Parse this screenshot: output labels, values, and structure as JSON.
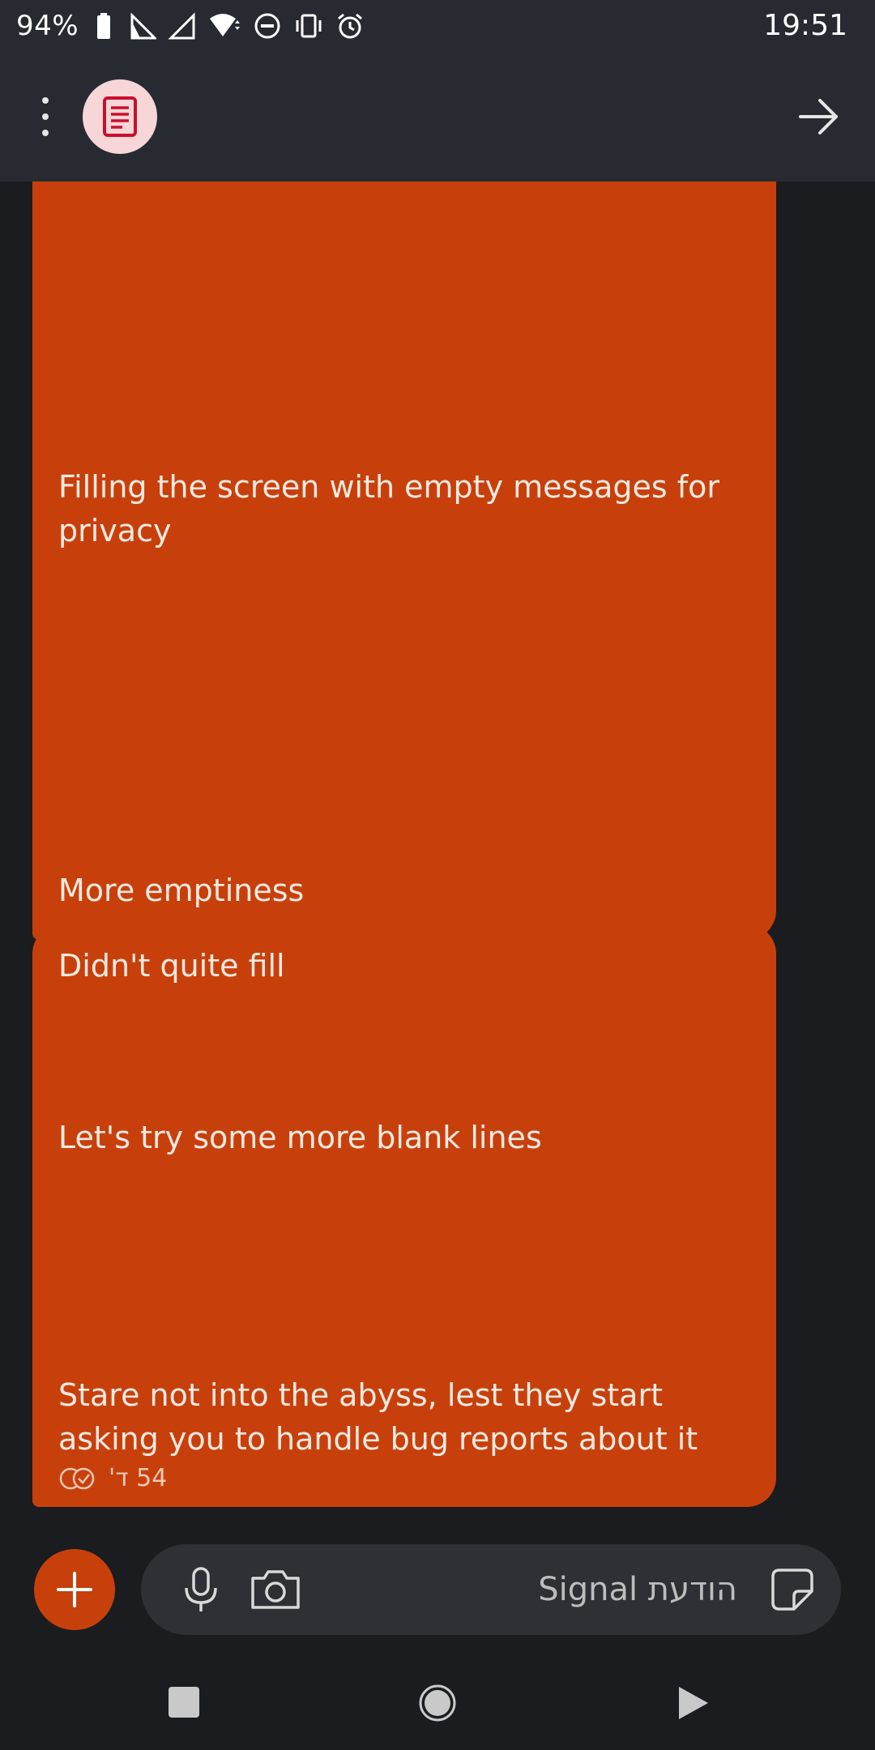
{
  "status_bar": {
    "battery": "94%",
    "time": "19:51",
    "icons": [
      "battery-icon",
      "signal-icon",
      "signal-icon",
      "wifi-icon",
      "dnd-icon",
      "vibrate-icon",
      "alarm-icon"
    ]
  },
  "header": {
    "menu_icon": "more-vert-icon",
    "avatar_icon": "note-icon",
    "forward_icon": "arrow-forward-icon"
  },
  "messages": [
    {
      "lines": [
        "Filling the screen with empty messages for privacy",
        "More emptiness"
      ]
    },
    {
      "lines": [
        "Didn't quite fill",
        "Let's try some more blank lines",
        "Stare not into the abyss, lest they start asking you to handle bug reports about it"
      ],
      "timestamp": "54 ד'"
    }
  ],
  "compose": {
    "placeholder": "הודעת Signal",
    "icons": [
      "add-icon",
      "mic-icon",
      "camera-icon",
      "sticker-icon"
    ]
  },
  "colors": {
    "bubble": "#c7400b",
    "header": "#272a31",
    "background": "#1b1c1f",
    "avatar_bg": "#f6d6d6",
    "avatar_icon": "#c8102e"
  }
}
